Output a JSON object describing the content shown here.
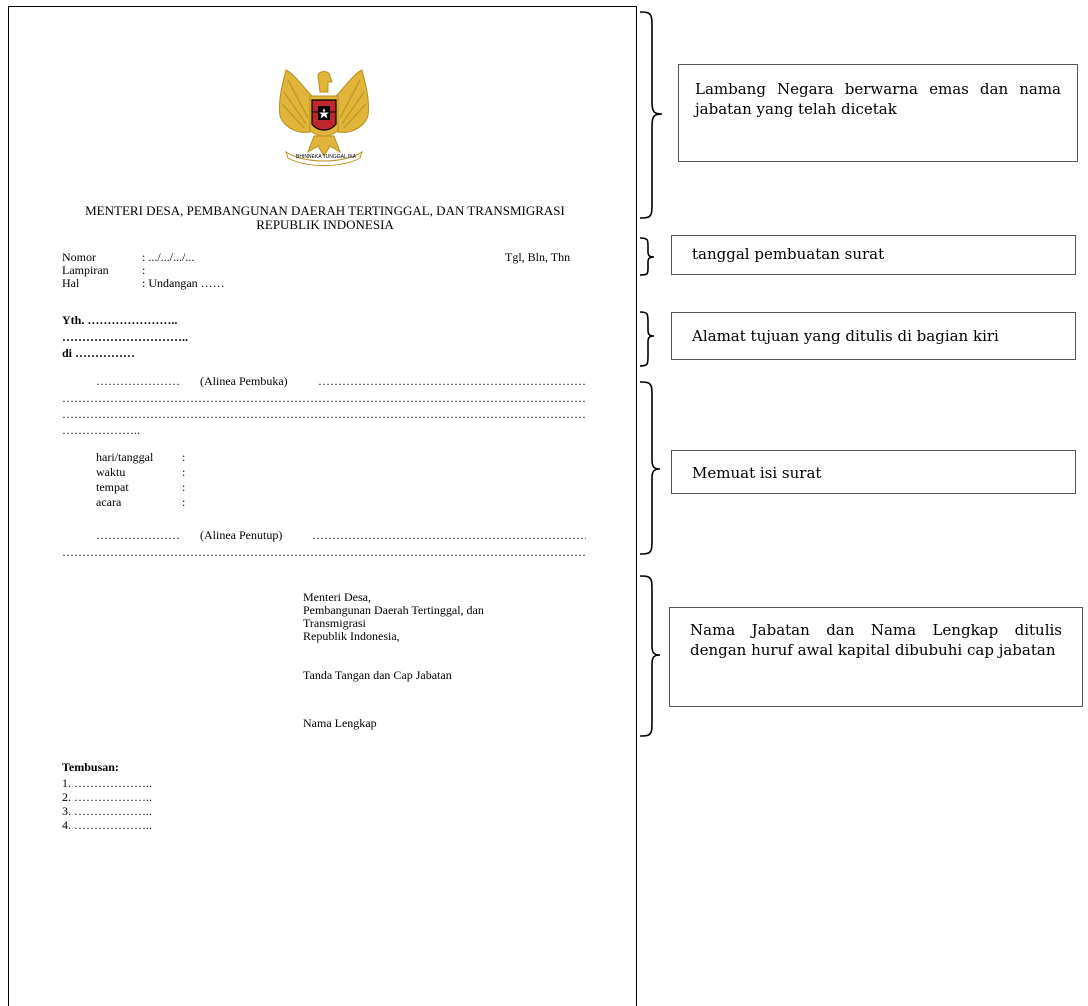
{
  "letter": {
    "header_line1": "MENTERI DESA, PEMBANGUNAN DAERAH TERTINGGAL, DAN TRANSMIGRASI",
    "header_line2": "REPUBLIK INDONESIA",
    "emblem_motto": "BHINNEKA TUNGGAL IKA",
    "nomor_label": "Nomor",
    "nomor_value": ": .../.../.../...",
    "lampiran_label": "Lampiran",
    "lampiran_value": ":",
    "hal_label": "Hal",
    "hal_value": ": Undangan ……",
    "date_placeholder": "Tgl, Bln, Thn",
    "yth": "Yth. …………………..",
    "addr_line": "…………………………..",
    "di": "di ……………",
    "pembuka_label": "(Alinea   Pembuka)",
    "penutup_label": "(Alinea   Penutup)",
    "dots_short": "…………………",
    "dots_long": "……………………………………………………………………………………………………………………………………………………………",
    "dots_tail": "………………..",
    "detail_items": [
      {
        "label": "hari/tanggal",
        "colon": ":"
      },
      {
        "label": "waktu",
        "colon": ":"
      },
      {
        "label": "tempat",
        "colon": ":"
      },
      {
        "label": "acara",
        "colon": ":"
      }
    ],
    "sign_line1": "Menteri Desa,",
    "sign_line2": "Pembangunan Daerah Tertinggal,  dan",
    "sign_line3": "Transmigrasi",
    "sign_line4": "Republik Indonesia,",
    "sign_stamp": "Tanda Tangan dan Cap Jabatan",
    "sign_name": "Nama Lengkap",
    "tembusan_label": "Tembusan:",
    "tembusan_items": [
      "1.   ………………..",
      "2.   ………………..",
      "3.   ………………..",
      "4.   ……………….."
    ]
  },
  "annotations": [
    {
      "text": "Lambang Negara berwarna emas dan nama jabatan yang telah dicetak"
    },
    {
      "text": "tanggal pembuatan surat"
    },
    {
      "text": "Alamat tujuan yang ditulis di bagian kiri"
    },
    {
      "text": "Memuat isi surat"
    },
    {
      "text": "Nama Jabatan dan Nama Lengkap ditulis dengan huruf awal kapital dibubuhi cap jabatan"
    }
  ],
  "colors": {
    "emblem_gold": "#e1b43a",
    "shield_red": "#c0272d",
    "border": "#000000"
  }
}
